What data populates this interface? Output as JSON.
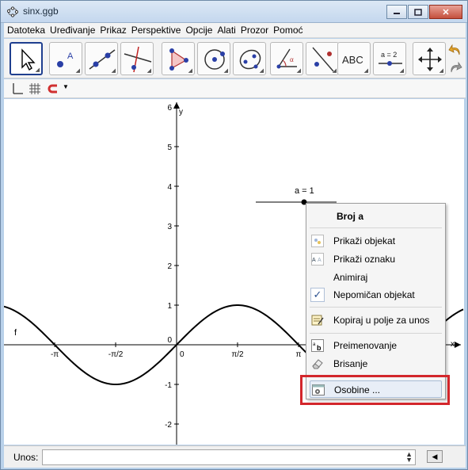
{
  "window": {
    "title": "sinx.ggb",
    "app_icon": "geogebra-icon",
    "buttons": [
      "minimize",
      "maximize",
      "close"
    ]
  },
  "menubar": {
    "items": [
      "Datoteka",
      "Uređivanje",
      "Prikaz",
      "Perspektive",
      "Opcije",
      "Alati",
      "Prozor",
      "Pomoć"
    ]
  },
  "toolbar": {
    "tools": [
      {
        "name": "move",
        "icon": "arrow-pointer-icon",
        "active": true
      },
      {
        "name": "point",
        "icon": "point-icon"
      },
      {
        "name": "line",
        "icon": "line-icon"
      },
      {
        "name": "perpendicular",
        "icon": "perpendicular-icon"
      },
      {
        "name": "polygon",
        "icon": "polygon-icon"
      },
      {
        "name": "circle",
        "icon": "circle-icon"
      },
      {
        "name": "ellipse",
        "icon": "conic-icon"
      },
      {
        "name": "angle",
        "icon": "angle-icon"
      },
      {
        "name": "reflect",
        "icon": "reflect-icon"
      },
      {
        "name": "text",
        "icon": "text-icon",
        "label": "ABC"
      },
      {
        "name": "slider",
        "icon": "slider-icon",
        "label": "a = 2"
      },
      {
        "name": "move-graphics",
        "icon": "move-view-icon"
      }
    ],
    "undo": "undo-icon",
    "redo": "redo-icon"
  },
  "stylebar": {
    "icons": [
      "axes-icon",
      "grid-icon",
      "magnet-icon"
    ]
  },
  "graphics": {
    "y_axis_label": "y",
    "x_axis_label": "x",
    "y_ticks": [
      "6",
      "5",
      "4",
      "3",
      "2",
      "1",
      "0",
      "-1",
      "-2"
    ],
    "x_ticks": [
      "-π",
      "-π/2",
      "0",
      "π/2",
      "π"
    ],
    "function_label": "f",
    "slider_label": "a = 1"
  },
  "chart_data": {
    "type": "line",
    "series": [
      {
        "name": "f",
        "x": [
          -3.93,
          -3.14,
          -2.36,
          -1.57,
          -0.79,
          0,
          0.79,
          1.57,
          2.36,
          3.14,
          3.93
        ],
        "y": [
          0.71,
          0,
          -0.71,
          -1,
          -0.71,
          0,
          0.71,
          1,
          0.71,
          0,
          -0.71
        ]
      }
    ],
    "xlabel": "x",
    "ylabel": "y",
    "ylim": [
      -2.4,
      6.2
    ],
    "grid": false
  },
  "context_menu": {
    "title": "Broj a",
    "items": [
      {
        "label": "Prikaži objekat",
        "icon": "show-object-icon"
      },
      {
        "label": "Prikaži oznaku",
        "icon": "show-label-icon"
      },
      {
        "label": "Animiraj",
        "icon": ""
      },
      {
        "label": "Nepomičan objekat",
        "icon": "checkmark-icon",
        "checked": true
      },
      {
        "label": "Kopiraj u polje za unos",
        "icon": "copy-to-input-icon"
      },
      {
        "label": "Preimenovanje",
        "icon": "rename-icon"
      },
      {
        "label": "Brisanje",
        "icon": "eraser-icon"
      },
      {
        "label": "Osobine ...",
        "icon": "properties-icon",
        "highlighted": true
      }
    ]
  },
  "inputbar": {
    "label": "Unos:",
    "value": ""
  }
}
